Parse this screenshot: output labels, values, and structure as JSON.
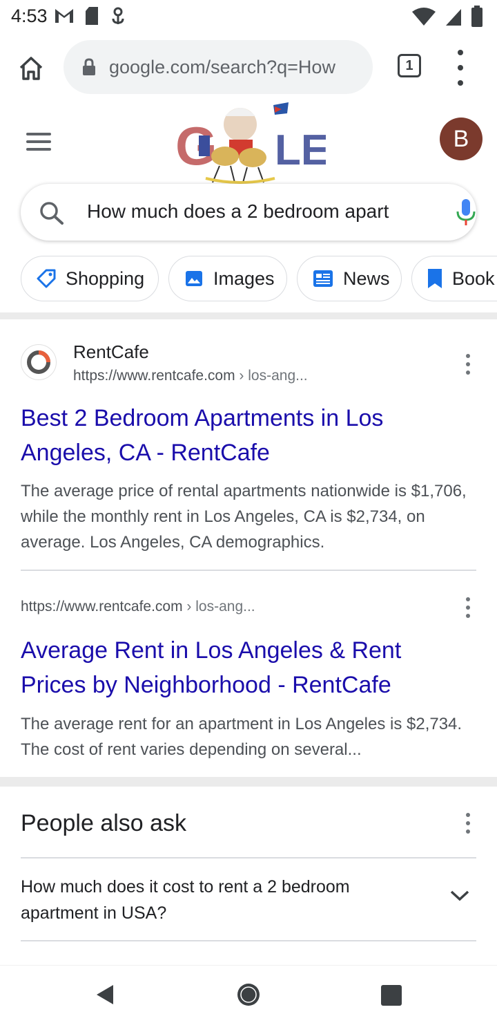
{
  "status_bar": {
    "time": "4:53",
    "left_icons": [
      "gmail-icon",
      "sd-card-icon",
      "usb-icon"
    ],
    "right_icons": [
      "wifi-icon",
      "signal-icon",
      "battery-icon"
    ]
  },
  "browser": {
    "url": "google.com/search?q=How",
    "tab_count": "1",
    "icons": [
      "home-icon",
      "lock-icon",
      "tabs-icon",
      "more-vert-icon"
    ]
  },
  "google": {
    "avatar_letter": "B",
    "search_query": "How much does a 2 bedroom apart",
    "chips": [
      {
        "label": "Shopping",
        "icon": "tag-icon"
      },
      {
        "label": "Images",
        "icon": "image-icon"
      },
      {
        "label": "News",
        "icon": "news-icon"
      },
      {
        "label": "Book",
        "icon": "book-icon"
      }
    ]
  },
  "results": [
    {
      "site_name": "RentCafe",
      "url": "https://www.rentcafe.com",
      "url_path": " › los-ang...",
      "title": "Best 2 Bedroom Apartments in Los Angeles, CA - RentCafe",
      "snippet": "The average price of rental apartments nationwide is $1,706, while the monthly rent in Los Angeles, CA is $2,734, on average. Los Angeles, CA demographics."
    },
    {
      "url": "https://www.rentcafe.com",
      "url_path": " › los-ang...",
      "title": "Average Rent in Los Angeles & Rent Prices by Neighborhood - RentCafe",
      "snippet": "The average rent for an apartment in Los Angeles is $2,734. The cost of rent varies depending on several..."
    }
  ],
  "people_also_ask": {
    "title": "People also ask",
    "questions": [
      "How much does it cost to rent a 2 bedroom apartment in USA?"
    ]
  },
  "colors": {
    "link": "#1a0dab",
    "avatar": "#7b3a2d",
    "snippet": "#4d5156"
  }
}
